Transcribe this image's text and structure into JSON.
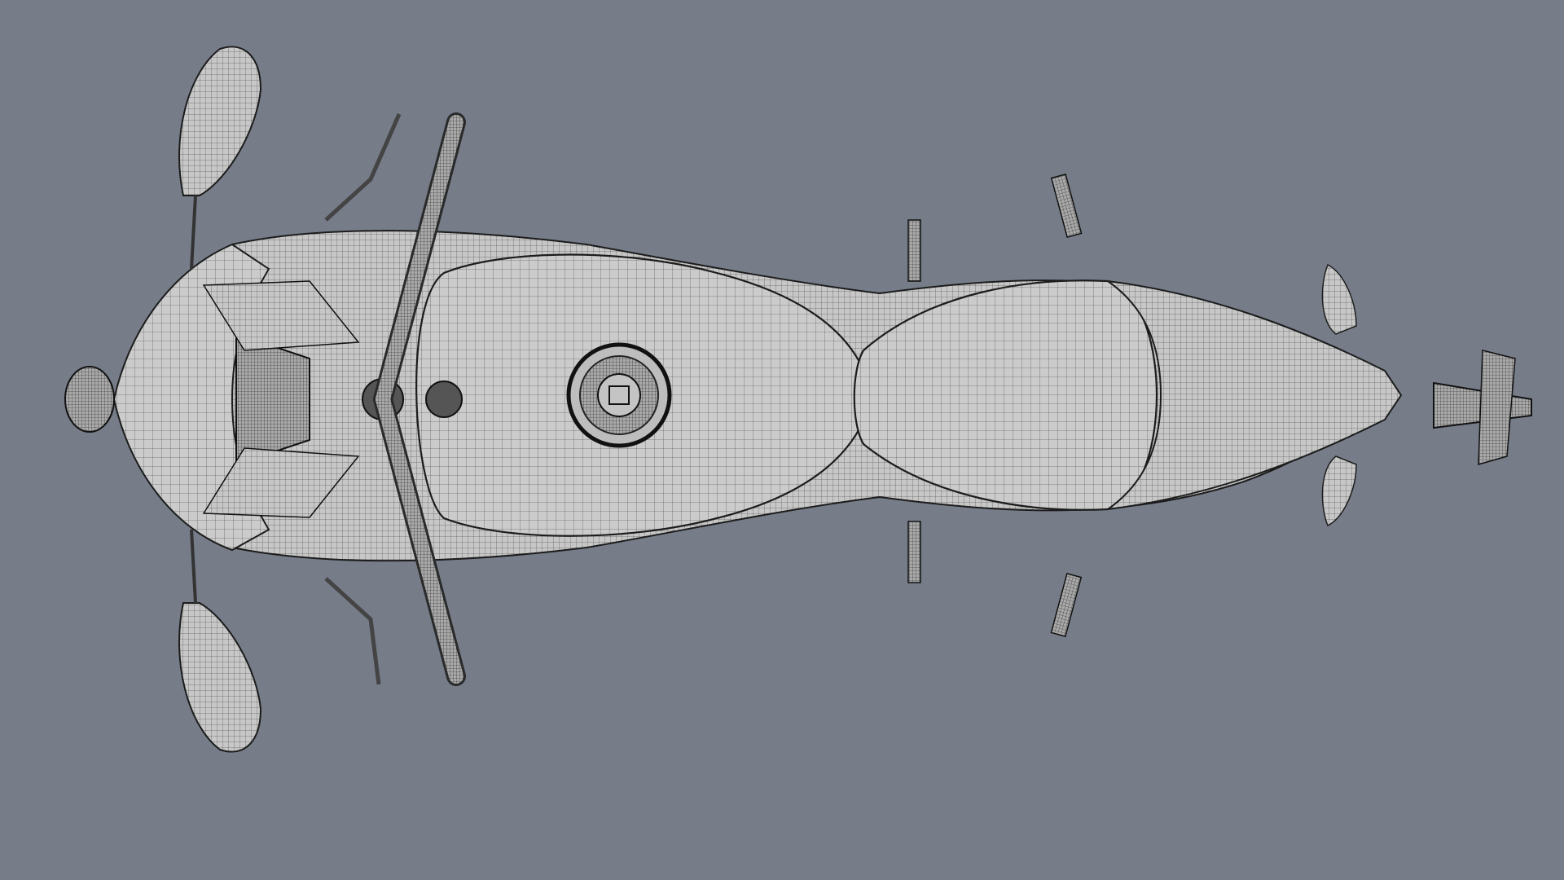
{
  "viewport": {
    "background_color": "#767d89",
    "view": "top",
    "display_mode": "wireframe"
  },
  "model": {
    "subject": "motorcycle",
    "surface_color": "#c9c9c9",
    "wire_color": "#222222",
    "dark_color": "#333333"
  }
}
